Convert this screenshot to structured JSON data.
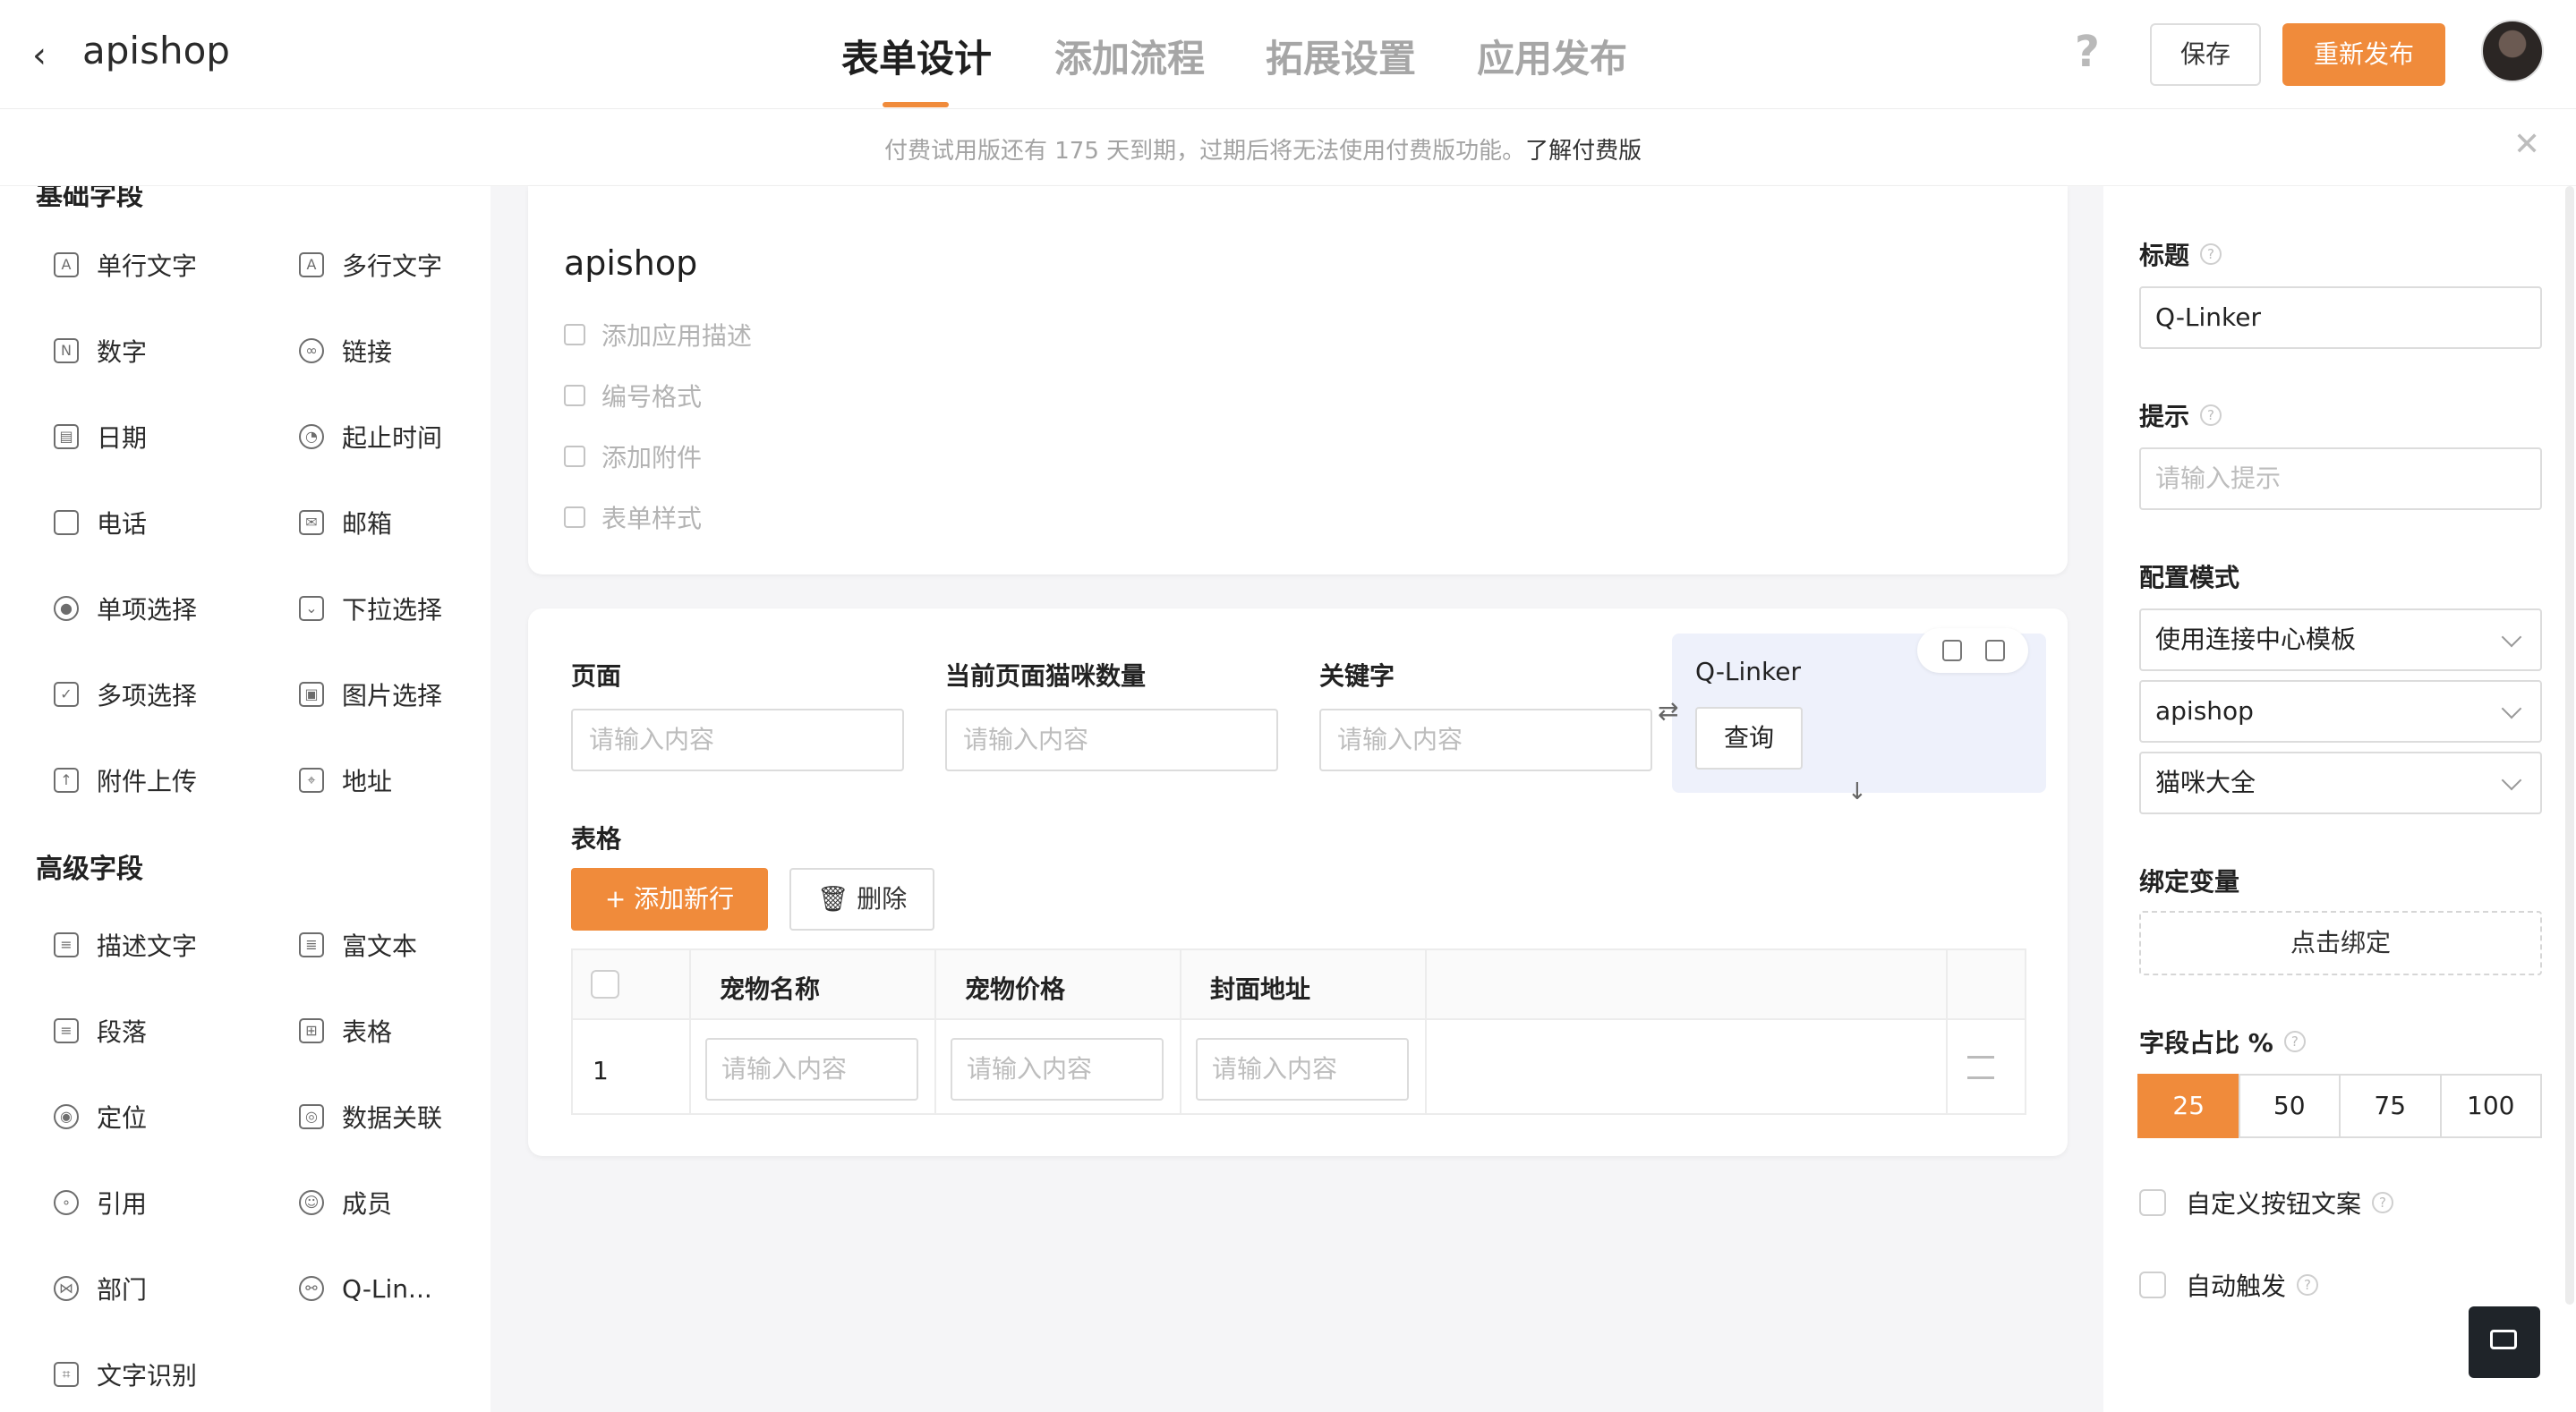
{
  "header": {
    "app_name": "apishop",
    "tabs": [
      {
        "label": "表单设计",
        "active": true
      },
      {
        "label": "添加流程",
        "active": false
      },
      {
        "label": "拓展设置",
        "active": false
      },
      {
        "label": "应用发布",
        "active": false
      }
    ],
    "help_glyph": "?",
    "save_label": "保存",
    "publish_label": "重新发布"
  },
  "trial_bar": {
    "text": "付费试用版还有 175 天到期，过期后将无法使用付费版功能。",
    "link": "了解付费版"
  },
  "palette": {
    "basic_title": "基础字段",
    "basic_fields": [
      {
        "label": "单行文字",
        "icon": "single-text-icon"
      },
      {
        "label": "多行文字",
        "icon": "multi-text-icon"
      },
      {
        "label": "数字",
        "icon": "number-icon"
      },
      {
        "label": "链接",
        "icon": "link-icon"
      },
      {
        "label": "日期",
        "icon": "calendar-icon"
      },
      {
        "label": "起止时间",
        "icon": "time-range-icon"
      },
      {
        "label": "电话",
        "icon": "phone-icon"
      },
      {
        "label": "邮箱",
        "icon": "mail-icon"
      },
      {
        "label": "单项选择",
        "icon": "radio-icon"
      },
      {
        "label": "下拉选择",
        "icon": "dropdown-icon"
      },
      {
        "label": "多项选择",
        "icon": "checkbox-icon"
      },
      {
        "label": "图片选择",
        "icon": "image-icon"
      },
      {
        "label": "附件上传",
        "icon": "upload-icon"
      },
      {
        "label": "地址",
        "icon": "address-icon"
      }
    ],
    "advanced_title": "高级字段",
    "advanced_fields": [
      {
        "label": "描述文字",
        "icon": "description-icon"
      },
      {
        "label": "富文本",
        "icon": "rich-text-icon"
      },
      {
        "label": "段落",
        "icon": "paragraph-icon"
      },
      {
        "label": "表格",
        "icon": "table-icon"
      },
      {
        "label": "定位",
        "icon": "location-icon"
      },
      {
        "label": "数据关联",
        "icon": "data-link-icon"
      },
      {
        "label": "引用",
        "icon": "reference-icon"
      },
      {
        "label": "成员",
        "icon": "member-icon"
      },
      {
        "label": "部门",
        "icon": "department-icon"
      },
      {
        "label": "Q-Lin...",
        "icon": "q-linker-icon"
      },
      {
        "label": "文字识别",
        "icon": "ocr-icon"
      }
    ]
  },
  "form_header": {
    "title": "apishop",
    "options": [
      "添加应用描述",
      "编号格式",
      "添加附件",
      "表单样式"
    ]
  },
  "form_fields": [
    {
      "label": "页面",
      "placeholder": "请输入内容"
    },
    {
      "label": "当前页面猫咪数量",
      "placeholder": "请输入内容"
    },
    {
      "label": "关键字",
      "placeholder": "请输入内容"
    }
  ],
  "qlinker": {
    "label": "Q-Linker",
    "query_label": "查询"
  },
  "table": {
    "label": "表格",
    "add_row_label": "+ 添加新行",
    "delete_label": "删除",
    "columns": [
      "宠物名称",
      "宠物价格",
      "封面地址"
    ],
    "rows": [
      {
        "index": "1",
        "placeholder": "请输入内容"
      }
    ]
  },
  "settings": {
    "title_label": "标题",
    "title_value": "Q-Linker",
    "hint_label": "提示",
    "hint_placeholder": "请输入提示",
    "config_label": "配置模式",
    "config_values": [
      "使用连接中心模板",
      "apishop",
      "猫咪大全"
    ],
    "bind_label": "绑定变量",
    "bind_button": "点击绑定",
    "ratio_label": "字段占比 %",
    "ratio_options": [
      "25",
      "50",
      "75",
      "100"
    ],
    "ratio_selected": "25",
    "custom_button_label": "自定义按钮文案",
    "auto_trigger_label": "自动触发"
  },
  "colors": {
    "accent": "#f08b3b",
    "qlinker_bg": "#eef1fb",
    "chat_button": "#1f2429"
  }
}
